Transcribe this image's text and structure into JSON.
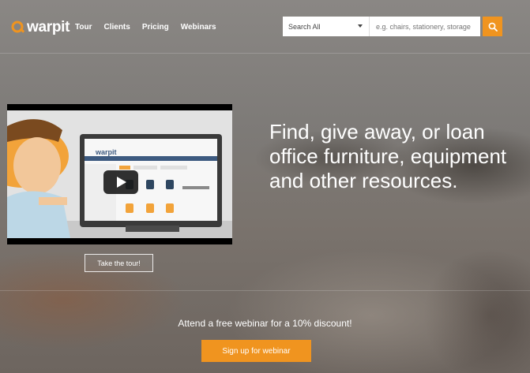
{
  "header": {
    "logo_text": "warpit",
    "nav": [
      {
        "label": "Tour"
      },
      {
        "label": "Clients"
      },
      {
        "label": "Pricing"
      },
      {
        "label": "Webinars"
      }
    ],
    "search": {
      "category_selected": "Search All",
      "placeholder": "e.g. chairs, stationery, storage",
      "button_icon": "search-icon"
    }
  },
  "hero": {
    "headline": "Find, give away, or loan office furniture, equipment and other resources.",
    "video": {
      "inner_logo_text": "warpit",
      "play_icon": "play-icon"
    },
    "tour_button_label": "Take the tour!"
  },
  "webinar": {
    "promo_text": "Attend a free webinar for a 10% discount!",
    "button_label": "Sign up for webinar"
  },
  "colors": {
    "accent": "#f0941f",
    "text": "#ffffff"
  }
}
